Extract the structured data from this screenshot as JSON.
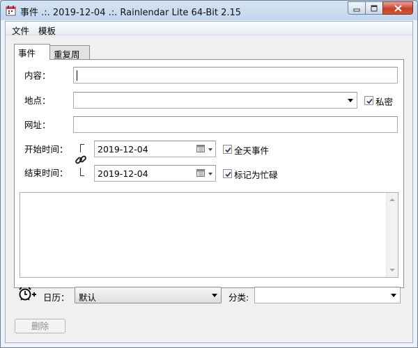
{
  "window": {
    "title": "事件 .:. 2019-12-04 .:. Rainlendar Lite 64-Bit 2.15",
    "accent": "#c7412a"
  },
  "menu": {
    "items": [
      "文件",
      "模板"
    ]
  },
  "tabs": [
    {
      "label": "事件",
      "active": true
    },
    {
      "label": "重复周期",
      "active": false
    }
  ],
  "form": {
    "content_label": "内容：",
    "content_value": "",
    "location_label": "地点：",
    "location_value": "",
    "private_label": "私密",
    "private_checked": true,
    "url_label": "网址：",
    "url_value": "",
    "start_label": "开始时间：",
    "start_date": "2019-12-04",
    "allday_label": "全天事件",
    "allday_checked": true,
    "end_label": "结束时间：",
    "end_date": "2019-12-04",
    "busy_label": "标记为忙碌",
    "busy_checked": true,
    "memo_value": ""
  },
  "bottom": {
    "calendar_label": "日历：",
    "calendar_value": "默认",
    "category_label": "分类:",
    "category_value": "",
    "delete_label": "删除",
    "delete_enabled": false
  },
  "icons": {
    "app": "calendar-app-icon",
    "link": "chain-link-icon",
    "alarm": "alarm-clock-add-icon",
    "date_picker": "calendar-picker-icon"
  }
}
